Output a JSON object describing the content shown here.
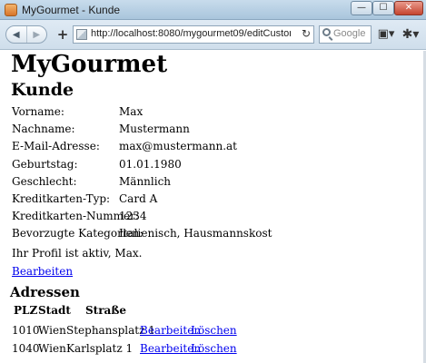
{
  "window": {
    "title": "MyGourmet - Kunde",
    "min_glyph": "—",
    "max_glyph": "☐",
    "close_glyph": "✕"
  },
  "toolbar": {
    "back_glyph": "◀",
    "forward_glyph": "▶",
    "new_tab_glyph": "+",
    "url": "http://localhost:8080/mygourmet09/editCustomer.jsf",
    "reload_glyph": "↻",
    "search_placeholder": "Google",
    "page_menu_glyph": "▣▾",
    "tools_menu_glyph": "✱▾"
  },
  "page": {
    "title": "MyGourmet",
    "heading": "Kunde",
    "fields": [
      {
        "label": "Vorname:",
        "value": "Max"
      },
      {
        "label": "Nachname:",
        "value": "Mustermann"
      },
      {
        "label": "E-Mail-Adresse:",
        "value": "max@mustermann.at"
      },
      {
        "label": "Geburtstag:",
        "value": "01.01.1980"
      },
      {
        "label": "Geschlecht:",
        "value": "Männlich"
      },
      {
        "label": "Kreditkarten-Typ:",
        "value": "Card A"
      },
      {
        "label": "Kreditkarten-Nummer:",
        "value": "1234"
      },
      {
        "label": "Bevorzugte Kategorien:",
        "value": "Italienisch, Hausmannskost"
      }
    ],
    "status_text": "Ihr Profil ist aktiv, Max.",
    "edit_link": "Bearbeiten",
    "addresses": {
      "heading": "Adressen",
      "columns": [
        "PLZ",
        "Stadt",
        "Straße"
      ],
      "rows": [
        {
          "plz": "1010",
          "stadt": "Wien",
          "strasse": "Stephansplatz 1",
          "edit": "Bearbeiten",
          "delete": "Löschen"
        },
        {
          "plz": "1040",
          "stadt": "Wien",
          "strasse": "Karlsplatz 1",
          "edit": "Bearbeiten",
          "delete": "Löschen"
        }
      ]
    }
  }
}
